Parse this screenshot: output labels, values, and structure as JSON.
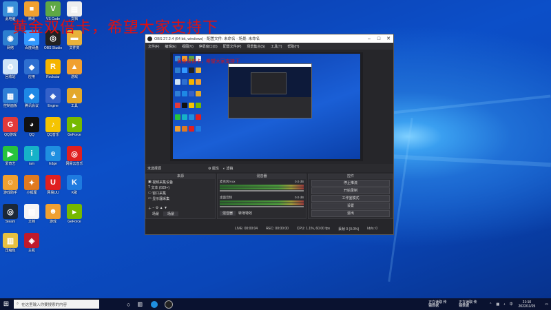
{
  "overlay_title": "黄金双倍卡，希望大家支持下",
  "desktop_icons": [
    {
      "label": "此电脑",
      "color": "#3a8fd8",
      "glyph": "▣"
    },
    {
      "label": "腾讯",
      "color": "#f0a030",
      "glyph": "■"
    },
    {
      "label": "VS Code",
      "color": "#5fa845",
      "glyph": "V"
    },
    {
      "label": "文档",
      "color": "#eeeeee",
      "glyph": "▤"
    },
    {
      "label": "网络",
      "color": "#2d7fd0",
      "glyph": "◉"
    },
    {
      "label": "百度网盘",
      "color": "#3399ff",
      "glyph": "☁"
    },
    {
      "label": "OBS Studio",
      "color": "#222222",
      "glyph": "◎"
    },
    {
      "label": "文件夹",
      "color": "#e8b23a",
      "glyph": "▬"
    },
    {
      "label": "回收站",
      "color": "#cfe4f8",
      "glyph": "♻"
    },
    {
      "label": "应用",
      "color": "#2e6fd0",
      "glyph": "◆"
    },
    {
      "label": "Rockstar",
      "color": "#f5b400",
      "glyph": "R"
    },
    {
      "label": "游戏",
      "color": "#f0a030",
      "glyph": "▲"
    },
    {
      "label": "控制面板",
      "color": "#2f7fd6",
      "glyph": "▦"
    },
    {
      "label": "腾讯会议",
      "color": "#1e88e5",
      "glyph": "◆"
    },
    {
      "label": "Engine",
      "color": "#3561c9",
      "glyph": "◈"
    },
    {
      "label": "工具",
      "color": "#e3a82a",
      "glyph": "▲"
    },
    {
      "label": "QQ游戏",
      "color": "#e23a3a",
      "glyph": "G"
    },
    {
      "label": "QQ",
      "color": "#111111",
      "glyph": "◕"
    },
    {
      "label": "QQ音乐",
      "color": "#f5c400",
      "glyph": "♪"
    },
    {
      "label": "GeForce",
      "color": "#76b900",
      "glyph": "▸"
    },
    {
      "label": "爱奇艺",
      "color": "#27c43d",
      "glyph": "▶"
    },
    {
      "label": "iam",
      "color": "#16b2c8",
      "glyph": "i"
    },
    {
      "label": "Edge",
      "color": "#1f8fe0",
      "glyph": "e"
    },
    {
      "label": "网易云音乐",
      "color": "#e02020",
      "glyph": "◎"
    },
    {
      "label": "游戏助手",
      "color": "#f0a030",
      "glyph": "☺"
    },
    {
      "label": "小狐狸",
      "color": "#e07a20",
      "glyph": "✦"
    },
    {
      "label": "网易UU",
      "color": "#e02020",
      "glyph": "U"
    },
    {
      "label": "K歌",
      "color": "#1e7be0",
      "glyph": "K"
    },
    {
      "label": "Steam",
      "color": "#1b2838",
      "glyph": "◎"
    },
    {
      "label": "文档",
      "color": "#f5f5f5",
      "glyph": "▤"
    },
    {
      "label": "游戏",
      "color": "#f0a030",
      "glyph": "☻"
    },
    {
      "label": "GeForce",
      "color": "#76b900",
      "glyph": "▸"
    },
    {
      "label": "压缩包",
      "color": "#e8c040",
      "glyph": "▥"
    },
    {
      "label": "主机",
      "color": "#c01a2a",
      "glyph": "◈"
    }
  ],
  "obs": {
    "title": "OBS 27.2.4 (64 bit, windows) - 配置文件: 未命名 - 场景: 未命名",
    "menu": [
      "文件(F)",
      "编辑(E)",
      "视图(V)",
      "停靠窗口(D)",
      "配置文件(P)",
      "场景集合(S)",
      "工具(T)",
      "帮助(H)"
    ],
    "preview_overlay": "黄金双倍卡，希望大家支持下",
    "scene_bar": {
      "label": "未选择源",
      "props": "属性",
      "filters": "滤镜"
    },
    "scenes": {
      "header": "场景",
      "tabs": [
        "场景",
        "场景"
      ]
    },
    "sources": {
      "header": "来源",
      "items": [
        "视频采集设备",
        "文本 (GDI+)",
        "窗口采集",
        "显示器采集"
      ]
    },
    "mixer": {
      "header": "混音器",
      "tracks": [
        {
          "name": "麦克风/Aux",
          "level": "0.0 dB"
        },
        {
          "name": "桌面音频",
          "level": "0.0 dB"
        }
      ],
      "tabs": [
        "混音器",
        "转场特效"
      ]
    },
    "controls": {
      "header": "控件",
      "buttons": [
        "停止推流",
        "开始录制",
        "工作室模式",
        "设置",
        "退出"
      ]
    },
    "status": {
      "live": "LIVE: 00:00:04",
      "rec": "REC: 00:00:00",
      "cpu": "CPU: 1.1%, 60.00 fps",
      "dropped": "丢帧 0 (0.0%)",
      "kbs": "kb/s: 0"
    }
  },
  "taskbar": {
    "search_placeholder": "在这里输入你要搜索的内容",
    "tray_items": [
      "正在读取 传输数据",
      "正在读取 传输数据"
    ],
    "time": "21:10",
    "date": "2022/11/25"
  }
}
